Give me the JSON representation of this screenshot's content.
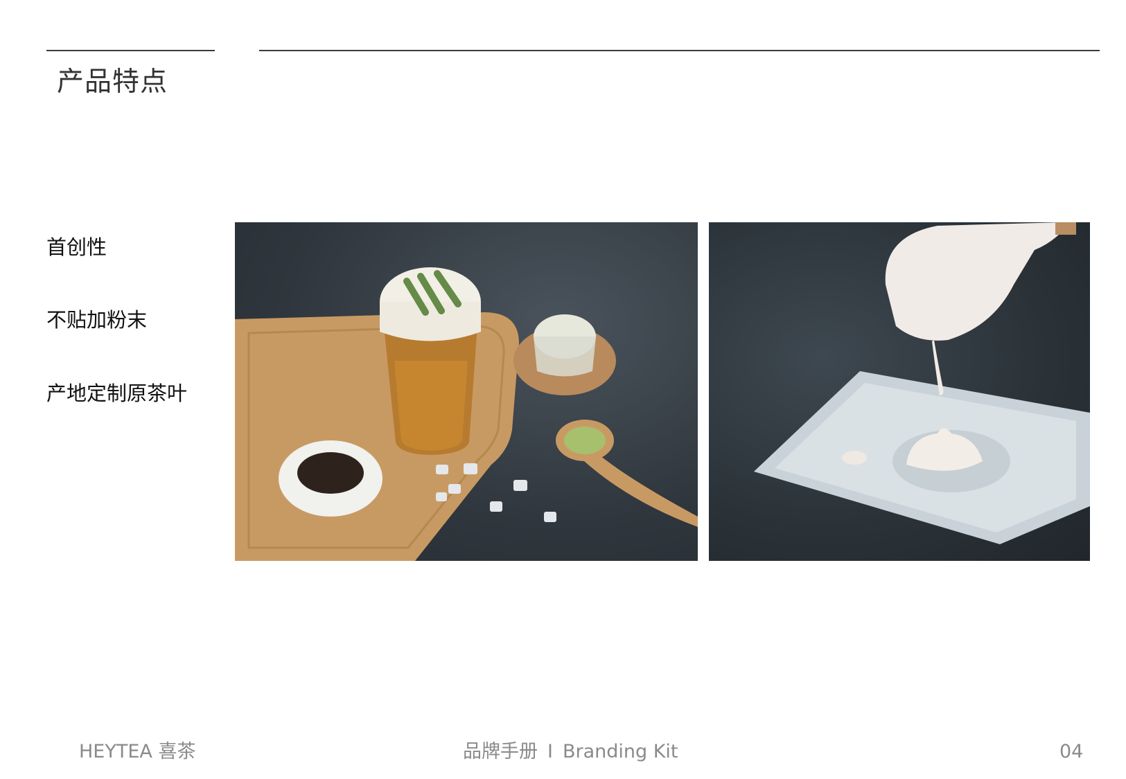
{
  "slide": {
    "title": "产品特点",
    "features": [
      "首创性",
      "不贴加粉末",
      "产地定制原茶叶"
    ]
  },
  "footer": {
    "brand": "HEYTEA 喜茶",
    "manual": "品牌手册",
    "separator": "I",
    "kit": "Branding Kit",
    "page_number": "04"
  },
  "colors": {
    "rule": "#3a3a3a",
    "footer_text": "#8a8a8a",
    "title_text": "#333333"
  }
}
